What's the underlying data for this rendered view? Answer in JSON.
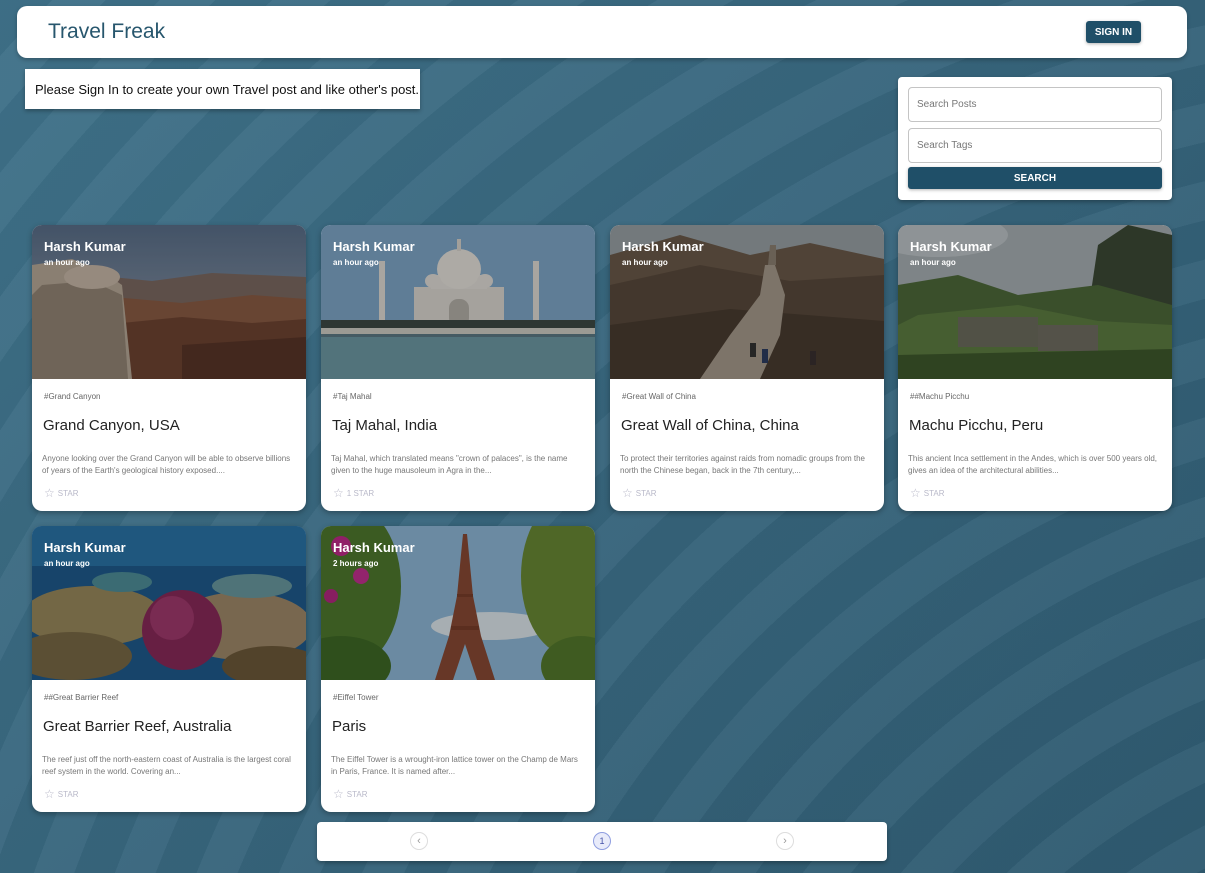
{
  "app": {
    "title": "Travel Freak",
    "sign_in_label": "SIGN IN"
  },
  "notice": "Please Sign In to create your own Travel post and like other's post.",
  "search": {
    "posts_placeholder": "Search Posts",
    "tags_placeholder": "Search Tags",
    "button_label": "SEARCH"
  },
  "posts": [
    {
      "author": "Harsh Kumar",
      "time": "an hour ago",
      "tags": "#Grand Canyon",
      "title": "Grand Canyon, USA",
      "message": "Anyone looking over the Grand Canyon will be able to observe billions of years of the Earth's geological history exposed....",
      "like_label": "STAR",
      "image": "grand-canyon"
    },
    {
      "author": "Harsh Kumar",
      "time": "an hour ago",
      "tags": "#Taj Mahal",
      "title": "Taj Mahal, India",
      "message": "Taj Mahal, which translated means \"crown of palaces\", is the name given to the huge mausoleum in Agra in the...",
      "like_label": "1 STAR",
      "image": "taj-mahal"
    },
    {
      "author": "Harsh Kumar",
      "time": "an hour ago",
      "tags": "#Great Wall of China",
      "title": "Great Wall of China, China",
      "message": "To protect their territories against raids from nomadic groups from the north the Chinese began, back in the 7th century,...",
      "like_label": "STAR",
      "image": "great-wall"
    },
    {
      "author": "Harsh Kumar",
      "time": "an hour ago",
      "tags": "##Machu Picchu",
      "title": "Machu Picchu, Peru",
      "message": "This ancient Inca settlement in the Andes, which is over 500 years old, gives an idea of the architectural abilities...",
      "like_label": "STAR",
      "image": "machu-picchu"
    },
    {
      "author": "Harsh Kumar",
      "time": "an hour ago",
      "tags": "##Great Barrier Reef",
      "title": "Great Barrier Reef, Australia",
      "message": "The reef just off the north-eastern coast of Australia is the largest coral reef system in the world. Covering an...",
      "like_label": "STAR",
      "image": "great-barrier-reef"
    },
    {
      "author": "Harsh Kumar",
      "time": "2 hours ago",
      "tags": "#Eiffel Tower",
      "title": "Paris",
      "message": "The Eiffel Tower is a wrought-iron lattice tower on the Champ de Mars in Paris, France. It is named after...",
      "like_label": "STAR",
      "image": "eiffel-tower"
    }
  ],
  "pagination": {
    "prev_icon": "chevron-left-icon",
    "current_page": "1",
    "next_icon": "chevron-right-icon"
  },
  "colors": {
    "primary": "#1f4f68",
    "brand_text": "#27566d",
    "background": "#3a6a81"
  }
}
